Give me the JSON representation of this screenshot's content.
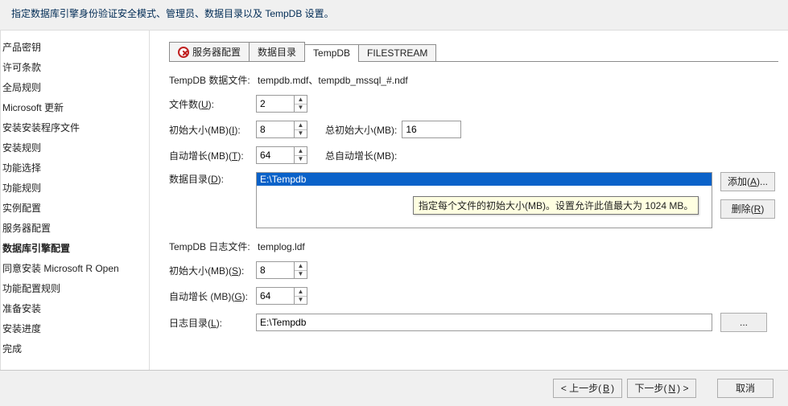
{
  "header_desc": "指定数据库引擎身份验证安全模式、管理员、数据目录以及 TempDB 设置。",
  "sidebar": {
    "items": [
      {
        "label": "产品密钥"
      },
      {
        "label": "许可条款"
      },
      {
        "label": "全局规则"
      },
      {
        "label": "Microsoft 更新"
      },
      {
        "label": "安装安装程序文件"
      },
      {
        "label": "安装规则"
      },
      {
        "label": "功能选择"
      },
      {
        "label": "功能规则"
      },
      {
        "label": "实例配置"
      },
      {
        "label": "服务器配置"
      },
      {
        "label": "数据库引擎配置"
      },
      {
        "label": "同意安装 Microsoft R Open"
      },
      {
        "label": "功能配置规则"
      },
      {
        "label": "准备安装"
      },
      {
        "label": "安装进度"
      },
      {
        "label": "完成"
      }
    ],
    "active_index": 10
  },
  "tabs": [
    {
      "label": "服务器配置",
      "has_error_icon": true
    },
    {
      "label": "数据目录"
    },
    {
      "label": "TempDB"
    },
    {
      "label": "FILESTREAM"
    }
  ],
  "active_tab": 2,
  "tempdb": {
    "data_files_label": "TempDB 数据文件:",
    "data_files_value": "tempdb.mdf、tempdb_mssql_#.ndf",
    "file_count_label": "文件数(U):",
    "file_count_hotkey": "U",
    "file_count": "2",
    "init_size_label": "初始大小(MB)(I):",
    "init_size_hotkey": "I",
    "init_size": "8",
    "total_init_label": "总初始大小(MB):",
    "total_init": "16",
    "auto_grow_label": "自动增长(MB)(T):",
    "auto_grow_hotkey": "T",
    "auto_grow": "64",
    "total_auto_label": "总自动增长(MB):",
    "data_dir_label": "数据目录(D):",
    "data_dir_hotkey": "D",
    "data_dirs": [
      {
        "path": "E:\\Tempdb",
        "selected": true
      }
    ],
    "add_btn": "添加(A)...",
    "add_hotkey": "A",
    "remove_btn": "删除(R)",
    "remove_hotkey": "R",
    "log_files_label": "TempDB 日志文件:",
    "log_files_value": "templog.ldf",
    "log_init_label": "初始大小(MB)(S):",
    "log_init_hotkey": "S",
    "log_init": "8",
    "log_auto_label": "自动增长 (MB)(G):",
    "log_auto_hotkey": "G",
    "log_auto": "64",
    "log_dir_label": "日志目录(L):",
    "log_dir_hotkey": "L",
    "log_dir": "E:\\Tempdb",
    "browse_btn": "..."
  },
  "tooltip": "指定每个文件的初始大小(MB)。设置允许此值最大为 1024 MB。",
  "footer": {
    "back": "< 上一步(B)",
    "back_hotkey": "B",
    "next": "下一步(N) >",
    "next_hotkey": "N",
    "cancel": "取消"
  }
}
